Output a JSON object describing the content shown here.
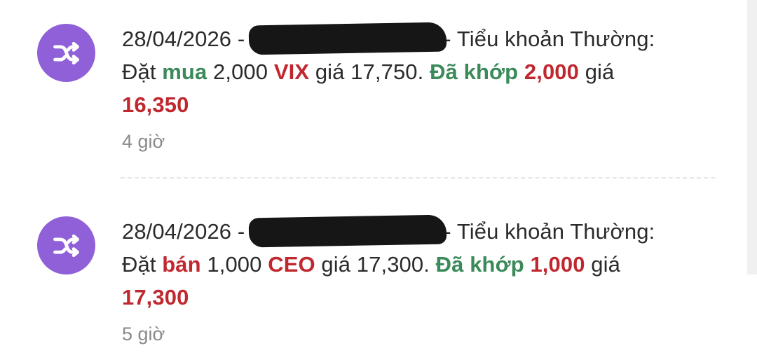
{
  "colors": {
    "avatar_bg": "#8f60d8",
    "green_text": "#3a8a5a",
    "red_text": "#c0282f",
    "body_text": "#2b2b2b",
    "time_text": "#8a8a8a"
  },
  "notifications": [
    {
      "icon": "shuffle-icon",
      "date_prefix": "28/04/2026 -",
      "account_suffix": "- Tiểu khoản Thường:",
      "order_label": "Đặt",
      "side": "mua",
      "quantity": "2,000",
      "symbol": "VIX",
      "price_label": "giá",
      "order_price": "17,750.",
      "matched_label": "Đã khớp",
      "matched_quantity": "2,000",
      "matched_price_label": "giá",
      "matched_price": "16,350",
      "time_ago": "4 giờ"
    },
    {
      "icon": "shuffle-icon",
      "date_prefix": "28/04/2026 -",
      "account_suffix": "- Tiểu khoản Thường:",
      "order_label": "Đặt",
      "side": "bán",
      "quantity": "1,000",
      "symbol": "CEO",
      "price_label": "giá",
      "order_price": "17,300.",
      "matched_label": "Đã khớp",
      "matched_quantity": "1,000",
      "matched_price_label": "giá",
      "matched_price": "17,300",
      "time_ago": "5 giờ"
    }
  ]
}
